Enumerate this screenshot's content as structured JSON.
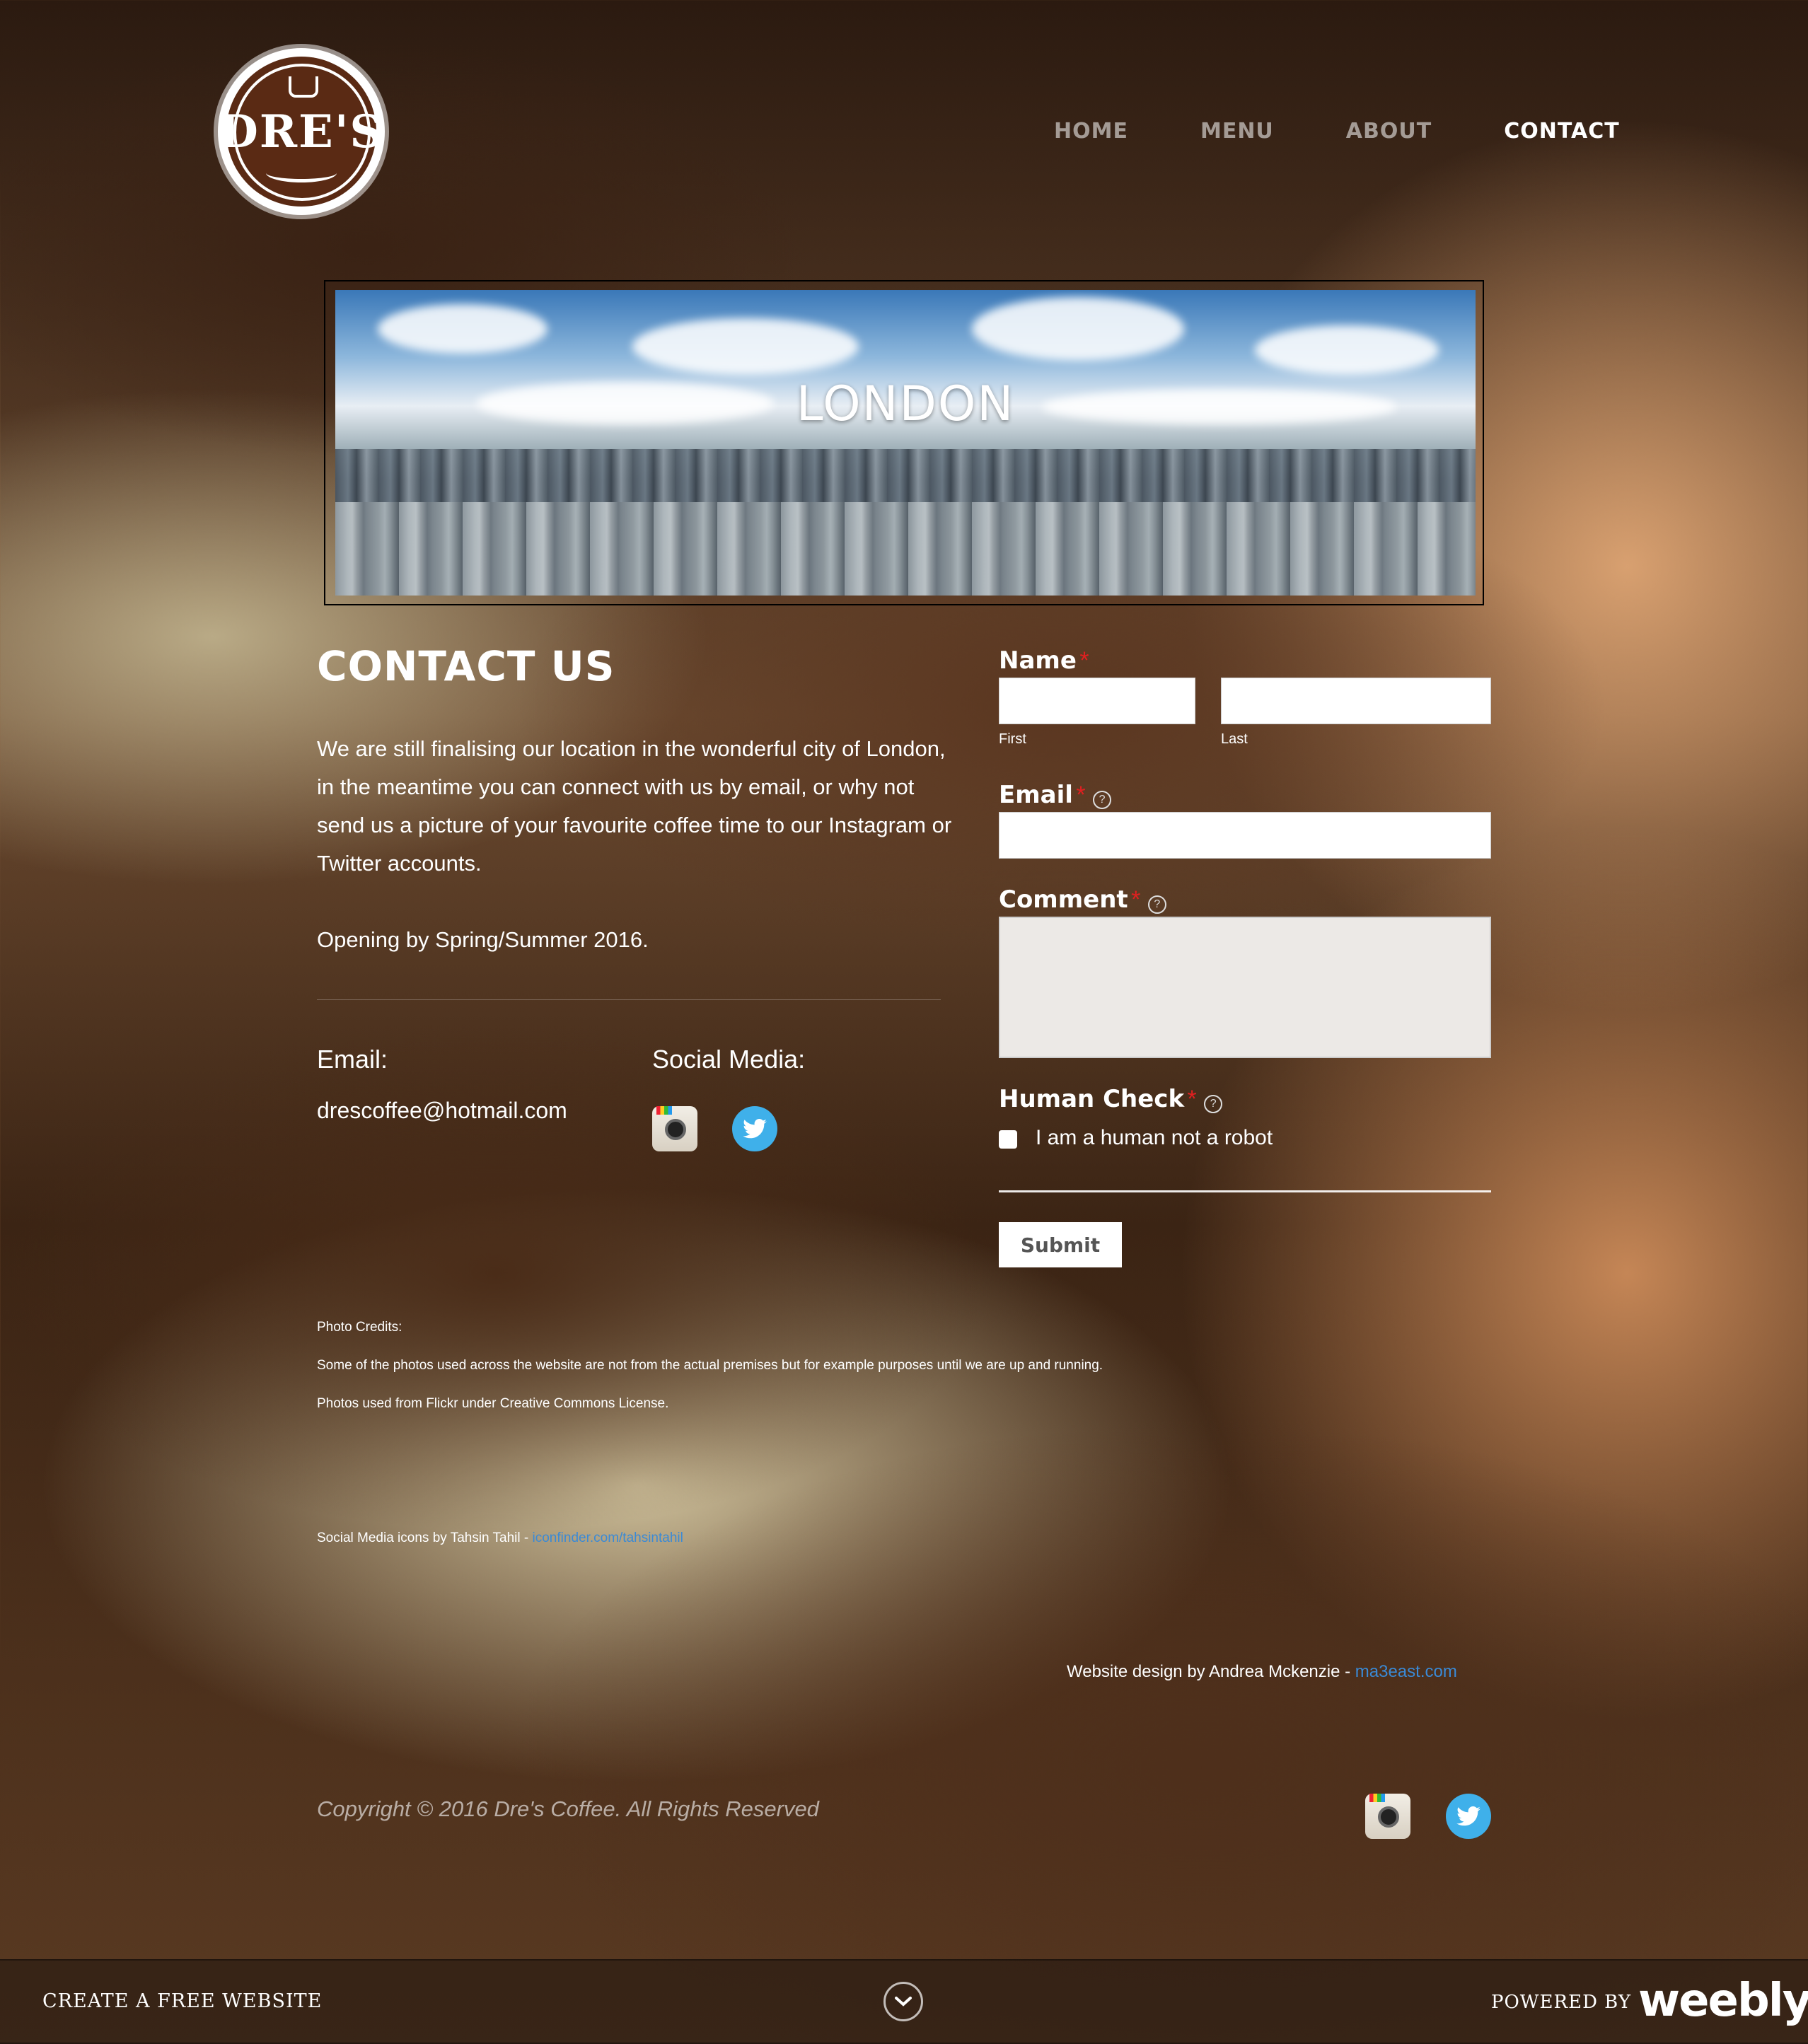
{
  "header": {
    "logo_text": "DRE'S",
    "nav": [
      {
        "label": "HOME"
      },
      {
        "label": "MENU"
      },
      {
        "label": "ABOUT"
      },
      {
        "label": "CONTACT"
      }
    ]
  },
  "banner": {
    "title": "LONDON"
  },
  "contact": {
    "title": "CONTACT US",
    "intro": "We are still finalising our location in the wonderful city of London, in the meantime you can connect with us by email, or why not send us a picture of your favourite coffee time to our Instagram or Twitter accounts.",
    "opening": "Opening by Spring/Summer 2016.",
    "email_label": "Email:",
    "email_value": "drescoffee@hotmail.com",
    "social_label": "Social Media:"
  },
  "form": {
    "name_label": "Name",
    "first_label": "First",
    "last_label": "Last",
    "email_label": "Email",
    "comment_label": "Comment",
    "human_label": "Human Check",
    "robot_label": "I am a human not a robot",
    "required_mark": "*",
    "help_mark": "?",
    "submit_label": "Submit"
  },
  "credits": {
    "photo_heading": "Photo Credits:",
    "photo_line1": "Some of the photos used across the website are not from the actual premises but for example purposes until we are up and running.",
    "photo_line2": "Photos used from Flickr under Creative Commons License.",
    "icons_text": "Social Media icons by Tahsin Tahil - ",
    "icons_link": "iconfinder.com/tahsintahil",
    "design_text": "Website design by Andrea Mckenzie - ",
    "design_link": "ma3east.com"
  },
  "footer": {
    "copyright": "Copyright © 2016 Dre's Coffee. All Rights Reserved"
  },
  "weebly": {
    "create": "CREATE A FREE WEBSITE",
    "powered": "POWERED BY",
    "logo": "weebly"
  },
  "colors": {
    "required": "#e02020",
    "link": "#3a8ad6",
    "twitter": "#3fb0ea"
  }
}
